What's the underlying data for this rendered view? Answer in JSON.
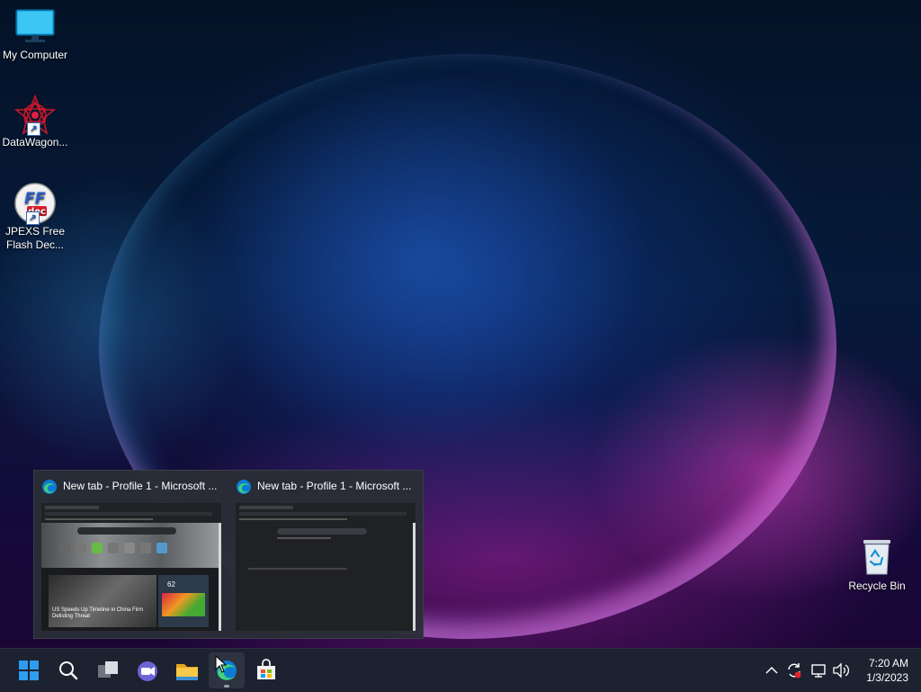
{
  "desktop": {
    "icons": [
      {
        "label": "My Computer",
        "icon": "monitor-icon"
      },
      {
        "label": "DataWagon...",
        "icon": "datawagon-icon"
      },
      {
        "label": "JPEXS Free Flash Dec...",
        "label_line1": "JPEXS Free",
        "label_line2": "Flash Dec...",
        "icon": "ffdec-icon"
      },
      {
        "label": "Recycle Bin",
        "icon": "recycle-bin-icon"
      }
    ]
  },
  "previews": [
    {
      "title": "New tab - Profile 1 - Microsoft ...",
      "headline": "US Speeds Up Timeline in China Firm Delisting Threat",
      "weather_temp": "62"
    },
    {
      "title": "New tab - Profile 1 - Microsoft ..."
    }
  ],
  "taskbar": {
    "apps": [
      "start-icon",
      "search-icon",
      "task-view-icon",
      "chat-icon",
      "file-explorer-icon",
      "edge-icon",
      "store-icon"
    ],
    "active_app": "edge-icon"
  },
  "clock": {
    "time": "7:20 AM",
    "date": "1/3/2023"
  },
  "colors": {
    "taskbar_bg": "#1c2230",
    "flyout_bg": "#2a2e36",
    "accent": "#0a84d6"
  }
}
